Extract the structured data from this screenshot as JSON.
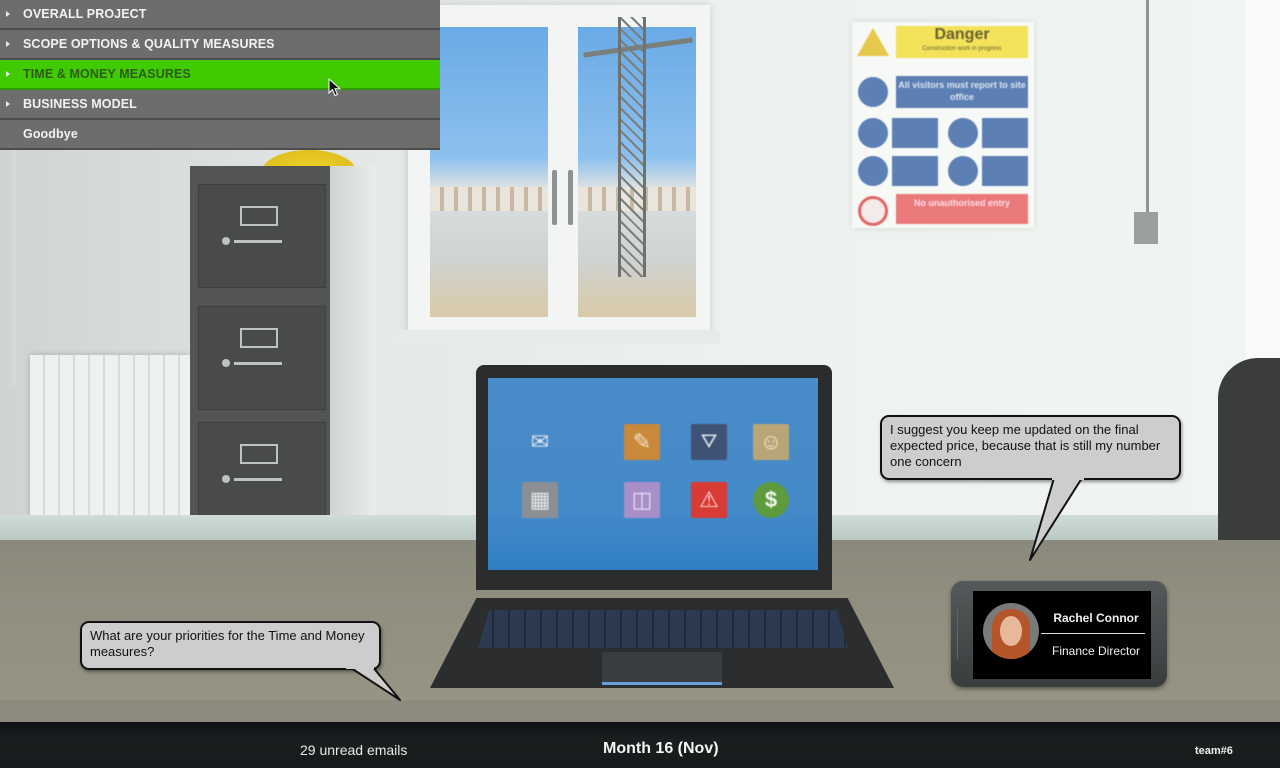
{
  "menu": {
    "items": [
      {
        "label": "OVERALL PROJECT",
        "has_arrow": true,
        "active": false
      },
      {
        "label": "SCOPE OPTIONS & QUALITY MEASURES",
        "has_arrow": true,
        "active": false
      },
      {
        "label": "TIME & MONEY MEASURES",
        "has_arrow": true,
        "active": true
      },
      {
        "label": "BUSINESS MODEL",
        "has_arrow": true,
        "active": false
      },
      {
        "label": "Goodbye",
        "has_arrow": false,
        "active": false
      }
    ]
  },
  "dialogue": {
    "player_question": "What are your priorities for the Time and Money measures?",
    "npc_response": "I suggest you keep me updated on the final expected price, because that is still my number one concern"
  },
  "contact_card": {
    "name": "Rachel Connor",
    "role": "Finance Director"
  },
  "status_bar": {
    "unread_emails": "29 unread emails",
    "month": "Month 16 (Nov)",
    "team": "team#6"
  },
  "danger_sign": {
    "title": "Danger",
    "subtitle": "Construction work in progress",
    "notice": "All visitors must report to site office",
    "restriction": "No unauthorised entry"
  },
  "laptop_apps": [
    {
      "icon": "mail-icon",
      "glyph": "✉",
      "color": "#cfd2d6"
    },
    {
      "icon": "document-edit-icon",
      "glyph": "✎",
      "color": "#c9893a"
    },
    {
      "icon": "compass-icon",
      "glyph": "⚠",
      "color": "#3f5275"
    },
    {
      "icon": "team-icon",
      "glyph": "☺",
      "color": "#b9a677"
    },
    {
      "icon": "calendar-icon",
      "glyph": "▦",
      "color": "#8b8f94"
    },
    {
      "icon": "chart-icon",
      "glyph": "◫",
      "color": "#a88fc8"
    },
    {
      "icon": "risk-warning-icon",
      "glyph": "⚠",
      "color": "#d83a34"
    },
    {
      "icon": "money-icon",
      "glyph": "$",
      "color": "#5d9b3e"
    }
  ],
  "colors": {
    "menu_bg": "#6d6d6d",
    "menu_active": "#3fcb00",
    "bubble_bg": "#cdcdcd",
    "status_bar_bg": "#151a1b"
  }
}
